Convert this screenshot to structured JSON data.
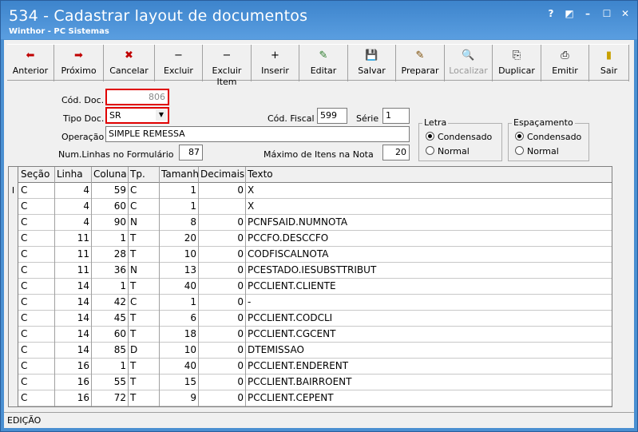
{
  "window": {
    "title": "534 - Cadastrar layout de documentos",
    "subtitle": "Winthor - PC Sistemas",
    "controls": [
      "?",
      "◩",
      "–",
      "☐",
      "✕"
    ]
  },
  "toolbar": [
    {
      "label": "Anterior",
      "icon": "arrow-left-icon",
      "glyph": "⬅",
      "color": "#c00000",
      "enabled": true
    },
    {
      "label": "Próximo",
      "icon": "arrow-right-icon",
      "glyph": "➡",
      "color": "#c00000",
      "enabled": true
    },
    {
      "label": "Cancelar",
      "icon": "cancel-icon",
      "glyph": "✖",
      "color": "#c00000",
      "enabled": true
    },
    {
      "label": "Excluir",
      "icon": "minus-icon",
      "glyph": "−",
      "color": "#000000",
      "enabled": true
    },
    {
      "label": "Excluir Item",
      "icon": "minus-icon",
      "glyph": "−",
      "color": "#000000",
      "enabled": true
    },
    {
      "label": "Inserir",
      "icon": "plus-icon",
      "glyph": "+",
      "color": "#000000",
      "enabled": true
    },
    {
      "label": "Editar",
      "icon": "edit-icon",
      "glyph": "✎",
      "color": "#2a7a2a",
      "enabled": true
    },
    {
      "label": "Salvar",
      "icon": "save-icon",
      "glyph": "💾",
      "color": "#000000",
      "enabled": true
    },
    {
      "label": "Preparar",
      "icon": "prepare-icon",
      "glyph": "✎",
      "color": "#7a4a00",
      "enabled": true
    },
    {
      "label": "Localizar",
      "icon": "find-icon",
      "glyph": "🔍",
      "color": "#9a9a9a",
      "enabled": false
    },
    {
      "label": "Duplicar",
      "icon": "duplicate-icon",
      "glyph": "⎘",
      "color": "#000000",
      "enabled": true
    },
    {
      "label": "Emitir",
      "icon": "print-icon",
      "glyph": "⎙",
      "color": "#000000",
      "enabled": true
    },
    {
      "label": "Sair",
      "icon": "exit-door-icon",
      "glyph": "▮",
      "color": "#c8a000",
      "enabled": true
    }
  ],
  "form": {
    "cod_doc_label": "Cód. Doc.",
    "cod_doc_value": "806",
    "tipo_doc_label": "Tipo Doc.",
    "tipo_doc_value": "SR",
    "cod_fiscal_label": "Cód. Fiscal",
    "cod_fiscal_value": "599",
    "serie_label": "Série",
    "serie_value": "1",
    "operacao_label": "Operação",
    "operacao_value": "SIMPLE REMESSA",
    "num_linhas_label": "Num.Linhas no Formulário",
    "num_linhas_value": "87",
    "max_itens_label": "Máximo de Itens na Nota",
    "max_itens_value": "20",
    "letra_label": "Letra",
    "letra_options": [
      "Condensado",
      "Normal"
    ],
    "letra_selected": 0,
    "espacamento_label": "Espaçamento",
    "espacamento_options": [
      "Condensado",
      "Normal"
    ],
    "espacamento_selected": 0
  },
  "table": {
    "columns": [
      "Seção",
      "Linha",
      "Coluna",
      "Tp.",
      "Tamanho",
      "Decimais",
      "Texto"
    ],
    "rows": [
      [
        "C",
        "4",
        "59",
        "C",
        "1",
        "0",
        "X"
      ],
      [
        "C",
        "4",
        "60",
        "C",
        "1",
        "",
        "X"
      ],
      [
        "C",
        "4",
        "90",
        "N",
        "8",
        "0",
        "PCNFSAID.NUMNOTA"
      ],
      [
        "C",
        "11",
        "1",
        "T",
        "20",
        "0",
        "PCCFO.DESCCFO"
      ],
      [
        "C",
        "11",
        "28",
        "T",
        "10",
        "0",
        "CODFISCALNOTA"
      ],
      [
        "C",
        "11",
        "36",
        "N",
        "13",
        "0",
        "PCESTADO.IESUBSTTRIBUT"
      ],
      [
        "C",
        "14",
        "1",
        "T",
        "40",
        "0",
        "PCCLIENT.CLIENTE"
      ],
      [
        "C",
        "14",
        "42",
        "C",
        "1",
        "0",
        "-"
      ],
      [
        "C",
        "14",
        "45",
        "T",
        "6",
        "0",
        "PCCLIENT.CODCLI"
      ],
      [
        "C",
        "14",
        "60",
        "T",
        "18",
        "0",
        "PCCLIENT.CGCENT"
      ],
      [
        "C",
        "14",
        "85",
        "D",
        "10",
        "0",
        "DTEMISSAO"
      ],
      [
        "C",
        "16",
        "1",
        "T",
        "40",
        "0",
        "PCCLIENT.ENDERENT"
      ],
      [
        "C",
        "16",
        "55",
        "T",
        "15",
        "0",
        "PCCLIENT.BAIRROENT"
      ],
      [
        "C",
        "16",
        "72",
        "T",
        "9",
        "0",
        "PCCLIENT.CEPENT"
      ]
    ],
    "current_row_marker": "I"
  },
  "status": {
    "text": "EDIÇÃO"
  }
}
